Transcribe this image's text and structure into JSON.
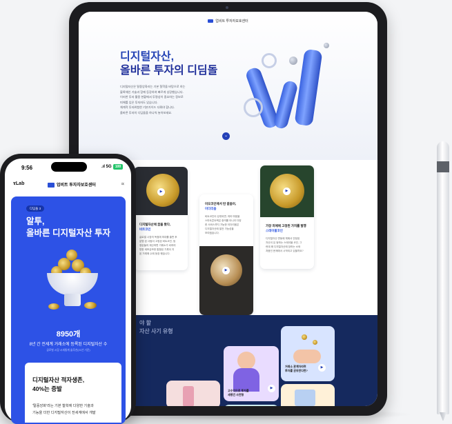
{
  "tablet": {
    "header_brand": "업비트 투자자보호센터",
    "hero": {
      "title_line1": "디지털자산,",
      "title_line2": "올바른 투자의 디딤돌",
      "desc_lines": [
        "디지털자산은 탈중앙화라는 기본 철학을 바탕으로 하는",
        "블록체인 기술과 함께 등장하여 빠르게 성장했습니다.",
        "이러한 투자 활용 현황에서 투명성이 중요하는 정보로",
        "피해를 입은 투자자도 있습니다.",
        "체계적 투자위험한 기본가이드 다뤄야 합니다.",
        "올바른 투자의 디딤돌을 하나씩 놓아보세요."
      ],
      "scroll_glyph": "⌄"
    },
    "cards": [
      {
        "title": "디지털자산에 꿈을 봤다,",
        "highlight": "비트코인",
        "text_lines": [
          "글로벌 시장의 독점에 최대를 출판 후",
          "분명 된 사람이 고정된 비트코인, 등",
          "정된들의 재산하면 거래소가 비하여",
          "방한 세보금보한 통합된 기록이 지",
          "된 거래에 수에 등장 했습니다."
        ]
      },
      {
        "title": "이오코인에서 탄 갈음이,",
        "highlight": "이더리움",
        "text_lines": [
          "비트코인이 성취되면, 여러 마음을",
          "스마트콘트랙은 중의를 아니라 다양",
          "한 서비스까지 가능한 이더리움은",
          "디지털자산에 발전 가능성을",
          "보여줬습니다."
        ]
      },
      {
        "title": "가장 외에에 고정된 가치를 발행",
        "highlight": "스테이블코인",
        "text_lines": [
          "디지털자산 변동에 체에서 안정된",
          "자산이 유 등하는 스테이블 코인, 그",
          "런데 왜 디지털자산에 장하는 소와",
          "처음인 문제에서 시작되고 있을까요?"
        ]
      }
    ],
    "dark_section": {
      "title_line1": "야 할",
      "title_line2": "자산 사기 유형",
      "cards": [
        {
          "caption_line1": "고수익으로 투자를",
          "caption_line2": "세뱅건 사전형"
        },
        {
          "caption_line1": "거래소 관계자라며",
          "caption_line2": "투자를 권유한다면?"
        },
        {
          "caption_line1": "",
          "caption_line2": ""
        },
        {
          "caption_line1": "",
          "caption_line2": ""
        },
        {
          "caption_line1": "",
          "caption_line2": ""
        }
      ]
    }
  },
  "phone": {
    "status": {
      "time": "9:56",
      "signal": ".ıl 5G",
      "battery": "100"
    },
    "nav": {
      "lab": "𝛕Lab",
      "brand": "업비트 투자자보호센터",
      "share_glyph": "∝"
    },
    "badge": "디딤돌 3",
    "title_line1": "알투,",
    "title_line2": "올바른 디지털자산 투자",
    "count": "8950개",
    "count_label": "8년 간 전세계 거래소에 등록된 디지털자산 수",
    "count_note": "글로벌 시장 시세통계 솔루션(21년 기준)",
    "card": {
      "title_line1": "디지털자산 적자생존,",
      "title_line2": "40%는 증발",
      "text_line1": "'탈중앙화'라는 기본 철학에 다양한 기술과",
      "text_line2": "기능을 더한 디지털자산이 전세계에서 개발"
    }
  },
  "colors": {
    "brand_blue": "#2d52e6",
    "dark_navy": "#15295e",
    "accent": "#2e56e0"
  }
}
